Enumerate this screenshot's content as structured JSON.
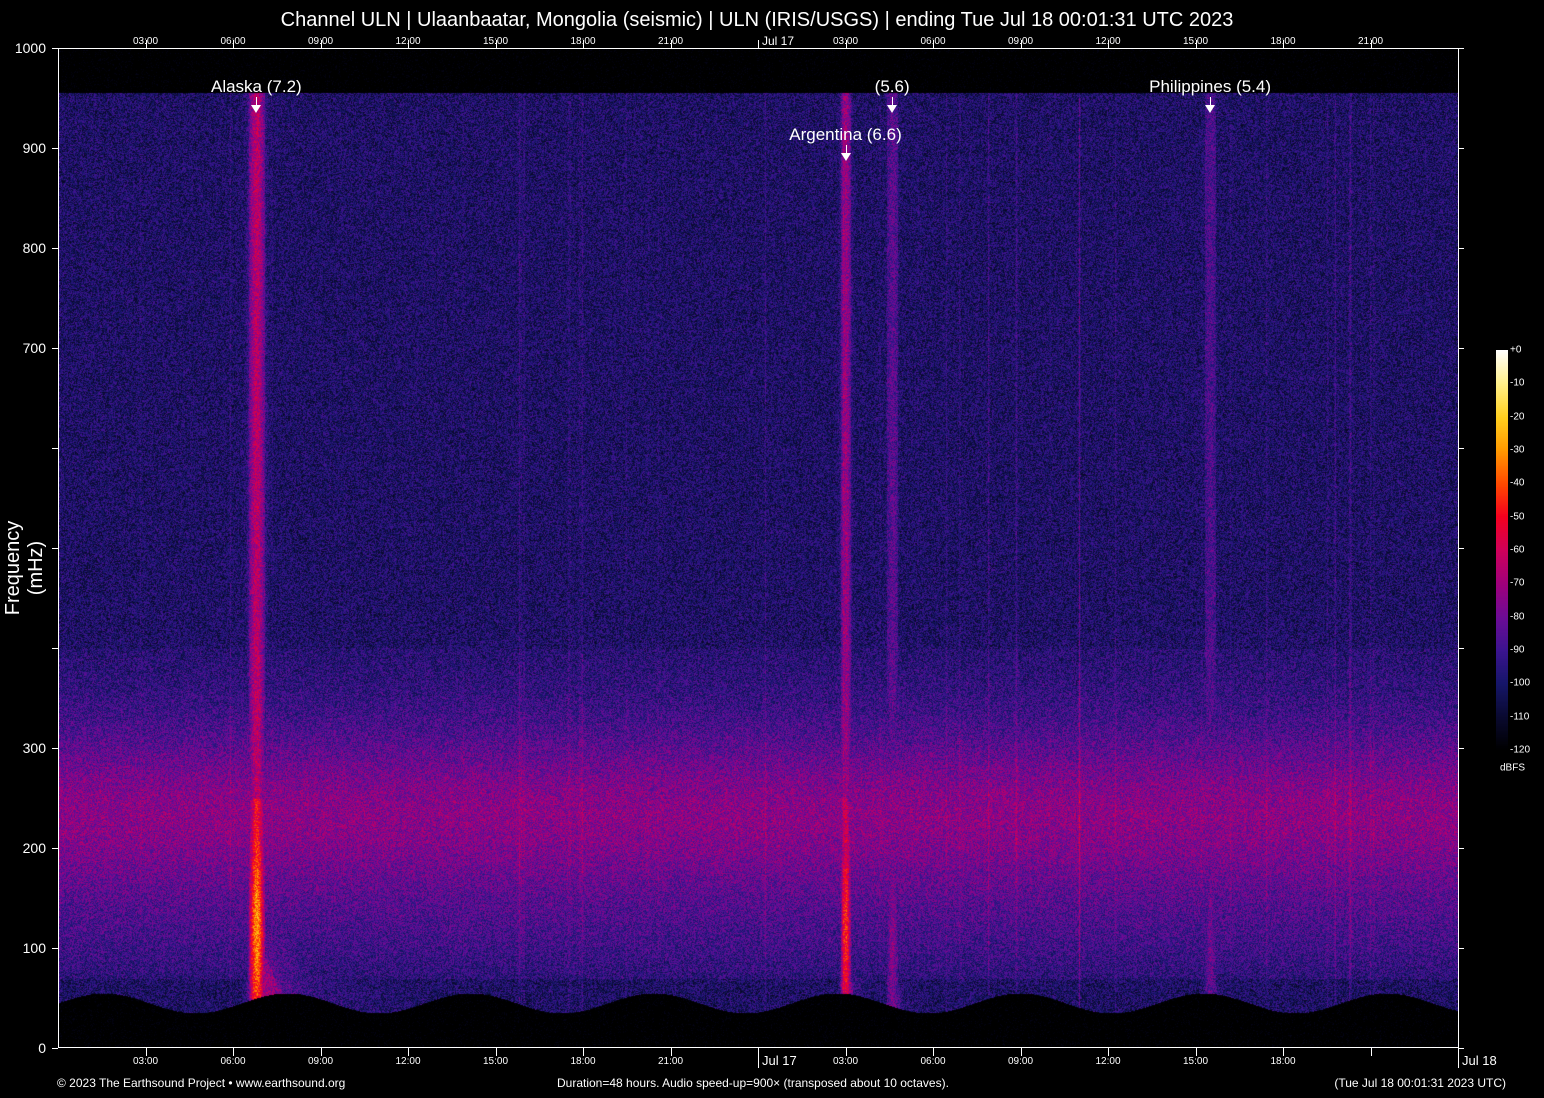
{
  "title": "Channel ULN | Ulaanbaatar, Mongolia (seismic) | ULN (IRIS/USGS) | ending Tue Jul 18 00:01:31 UTC 2023",
  "footer": {
    "copyright": "© 2023 The Earthsound Project • www.earthsound.org",
    "info": "Duration=48 hours. Audio speed-up=900× (transposed about 10 octaves).",
    "end_time": "(Tue Jul 18 00:01:31 2023 UTC)"
  },
  "chart_data": {
    "type": "heatmap",
    "title": "Channel ULN | Ulaanbaatar, Mongolia (seismic) | ULN (IRIS/USGS) | ending Tue Jul 18 00:01:31 UTC 2023",
    "xlabel": "",
    "ylabel": "Frequency (mHz)",
    "xlim_hours": [
      0,
      48
    ],
    "ylim": [
      0,
      1000
    ],
    "y_ticks": [
      0,
      100,
      200,
      300,
      400,
      500,
      600,
      700,
      800,
      900,
      1000
    ],
    "y_tick_labels": [
      "0",
      "100",
      "200",
      "300",
      "",
      "",
      "",
      "700",
      "800",
      "900",
      "1000"
    ],
    "x_top_labels": [
      {
        "h": 3,
        "label": "03:00"
      },
      {
        "h": 6,
        "label": "06:00"
      },
      {
        "h": 9,
        "label": "09:00"
      },
      {
        "h": 12,
        "label": "12:00"
      },
      {
        "h": 15,
        "label": "15:00"
      },
      {
        "h": 18,
        "label": "18:00"
      },
      {
        "h": 21,
        "label": "21:00"
      },
      {
        "h": 24,
        "label": "Jul 17"
      },
      {
        "h": 27,
        "label": "03:00"
      },
      {
        "h": 30,
        "label": "06:00"
      },
      {
        "h": 33,
        "label": "09:00"
      },
      {
        "h": 36,
        "label": "12:00"
      },
      {
        "h": 39,
        "label": "15:00"
      },
      {
        "h": 42,
        "label": "18:00"
      },
      {
        "h": 45,
        "label": "21:00"
      }
    ],
    "x_bottom_labels": [
      {
        "h": 3,
        "label": "03:00"
      },
      {
        "h": 6,
        "label": "06:00"
      },
      {
        "h": 9,
        "label": "09:00"
      },
      {
        "h": 12,
        "label": "12:00"
      },
      {
        "h": 15,
        "label": "15:00"
      },
      {
        "h": 18,
        "label": "18:00"
      },
      {
        "h": 21,
        "label": "21:00"
      },
      {
        "h": 24,
        "label": "Jul 17"
      },
      {
        "h": 27,
        "label": "03:00"
      },
      {
        "h": 30,
        "label": "06:00"
      },
      {
        "h": 33,
        "label": "09:00"
      },
      {
        "h": 36,
        "label": "12:00"
      },
      {
        "h": 39,
        "label": "15:00"
      },
      {
        "h": 42,
        "label": "18:00"
      },
      {
        "h": 45,
        "label": ""
      },
      {
        "h": 48,
        "label": "Jul 18"
      }
    ],
    "events": [
      {
        "label": "Alaska (7.2)",
        "hour": 6.8,
        "magnitude": 7.2,
        "label_row": 0
      },
      {
        "label": "Argentina (6.6)",
        "hour": 27.0,
        "magnitude": 6.6,
        "label_row": 1
      },
      {
        "label": "(5.6)",
        "hour": 28.6,
        "magnitude": 5.6,
        "label_row": 0
      },
      {
        "label": "Philippines (5.4)",
        "hour": 39.5,
        "magnitude": 5.4,
        "label_row": 0
      }
    ],
    "colorbar": {
      "unit": "dBFS",
      "range": [
        -120,
        0
      ],
      "tick_labels": [
        "+0",
        "-10",
        "-20",
        "-30",
        "-40",
        "-50",
        "-60",
        "-70",
        "-80",
        "-90",
        "-100",
        "-110",
        "-120"
      ],
      "colors": [
        "#000000",
        "#0a0a30",
        "#16166a",
        "#3c1490",
        "#6e0c96",
        "#a0007c",
        "#d0005a",
        "#f50020",
        "#ff4a00",
        "#ff9a00",
        "#ffd020",
        "#fff08a",
        "#ffffff"
      ]
    }
  }
}
